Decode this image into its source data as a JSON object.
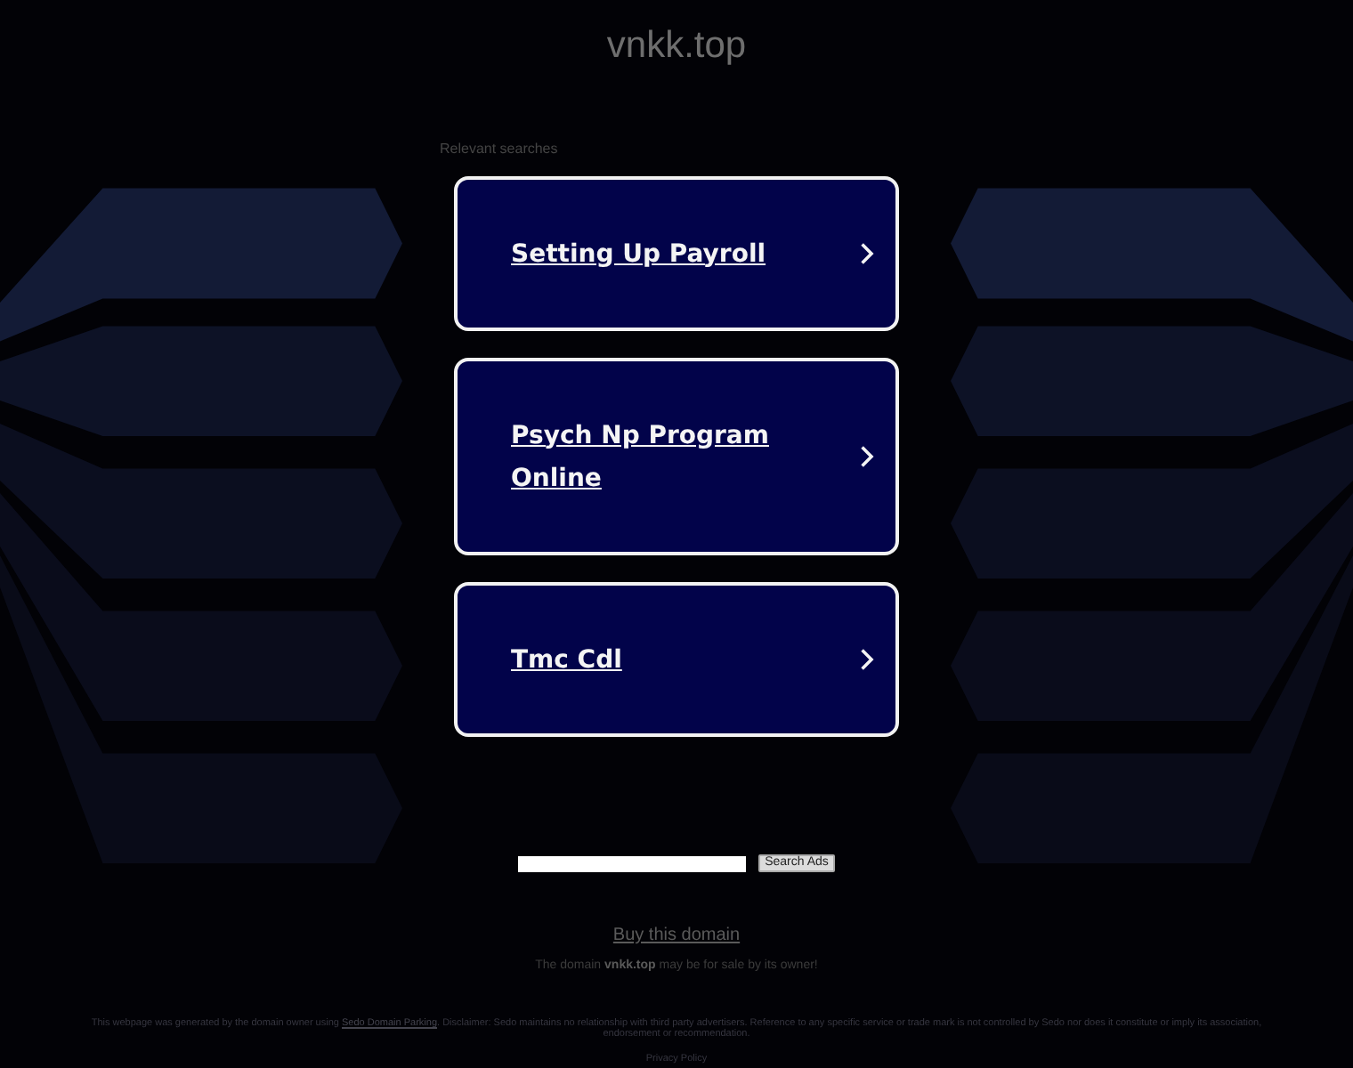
{
  "site_title": "vnkk.top",
  "related_searches": {
    "heading": "Relevant searches",
    "links": [
      {
        "label": "Setting Up Payroll"
      },
      {
        "label": "Psych Np Program Online"
      },
      {
        "label": "Tmc Cdl"
      }
    ]
  },
  "search": {
    "button": "Search Ads"
  },
  "domain_sale": {
    "link": "Buy this domain",
    "notice": "The domain **vnkk.top** may be for sale by its owner!"
  },
  "footer": {
    "disclaimer": {
      "before": "This webpage was generated by the domain owner using ",
      "link": "Sedo Domain Parking",
      "after": ". Disclaimer: Sedo maintains no relationship with third party advertisers. Reference to any specific service or trade mark is not controlled by Sedo nor does it constitute or imply its association, endorsement or recommendation."
    },
    "privacy_link": "Privacy Policy"
  }
}
